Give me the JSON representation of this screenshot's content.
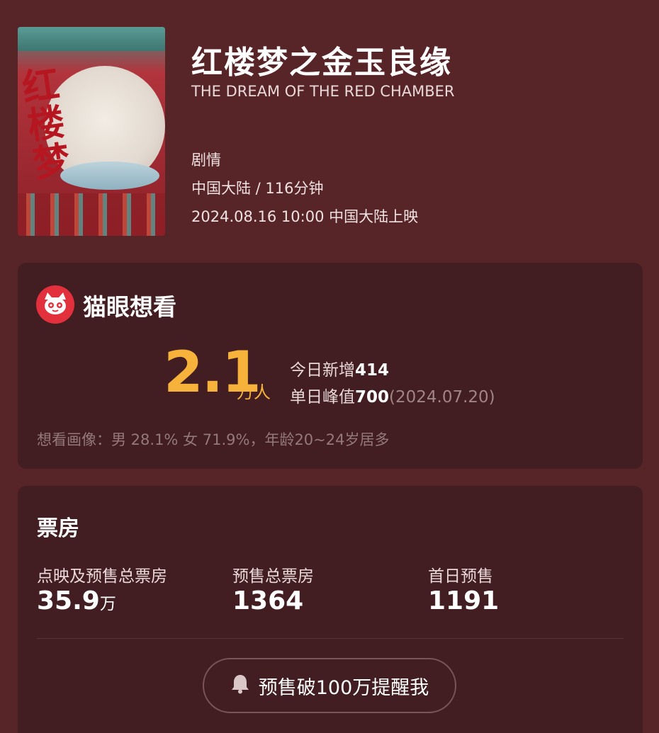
{
  "movie": {
    "title": "红楼梦之金玉良缘",
    "english_title": "THE DREAM OF THE RED CHAMBER",
    "genre": "剧情",
    "region_duration": "中国大陆 / 116分钟",
    "release": "2024.08.16 10:00 中国大陆上映",
    "poster_icon": "movie-poster"
  },
  "want": {
    "brand": "猫眼想看",
    "logo_icon": "cat-eye-logo",
    "count": "2.1",
    "count_unit": "万人",
    "today_label": "今日新增",
    "today_value": "414",
    "peak_label": "单日峰值",
    "peak_value": "700",
    "peak_date": "(2024.07.20)",
    "portrait": "想看画像：男 28.1% 女 71.9%，年龄20~24岁居多"
  },
  "box_office": {
    "title": "票房",
    "columns": [
      {
        "label": "点映及预售总票房",
        "value": "35.9",
        "unit": "万"
      },
      {
        "label": "预售总票房",
        "value": "1364",
        "unit": ""
      },
      {
        "label": "首日预售",
        "value": "1191",
        "unit": ""
      }
    ],
    "remind_label": "预售破100万提醒我",
    "remind_icon": "bell-icon"
  },
  "colors": {
    "background": "#572528",
    "card": "#421d21",
    "accent": "#f6b23b",
    "logo_red": "#e3303d"
  }
}
